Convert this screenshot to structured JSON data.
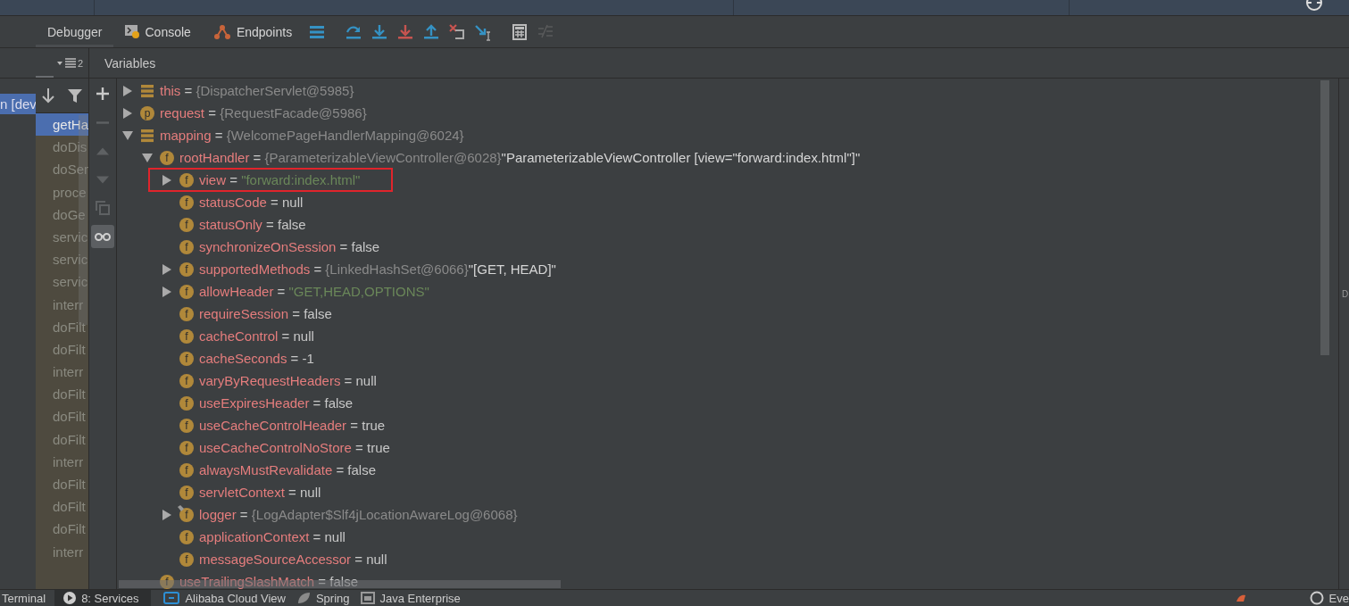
{
  "toolbar": {
    "tabs": [
      {
        "label": "Debugger",
        "selected": true,
        "kind": "plain"
      },
      {
        "label": "Console",
        "selected": false,
        "kind": "console"
      },
      {
        "label": "Endpoints",
        "selected": false,
        "kind": "endpoints"
      }
    ],
    "actions": [
      {
        "kind": "menu",
        "disabled": false
      },
      {
        "kind": "step-over",
        "disabled": false
      },
      {
        "kind": "step-into",
        "disabled": false
      },
      {
        "kind": "force-step-into",
        "disabled": false
      },
      {
        "kind": "step-out",
        "disabled": false
      },
      {
        "kind": "drop-frame",
        "disabled": false
      },
      {
        "kind": "run-to-cursor",
        "disabled": false
      },
      {
        "kind": "calculator",
        "disabled": false
      },
      {
        "kind": "trace",
        "disabled": true
      }
    ]
  },
  "threads": [
    {
      "label": "n [dev",
      "selected": true
    }
  ],
  "frames": {
    "count": "2",
    "items": [
      {
        "label": "getHa",
        "selected": true
      },
      {
        "label": "doDis",
        "selected": false
      },
      {
        "label": "doSer",
        "selected": false
      },
      {
        "label": "proce",
        "selected": false
      },
      {
        "label": "doGe",
        "selected": false
      },
      {
        "label": "servic",
        "selected": false
      },
      {
        "label": "servic",
        "selected": false
      },
      {
        "label": "servic",
        "selected": false
      },
      {
        "label": "interr",
        "selected": false
      },
      {
        "label": "doFilt",
        "selected": false
      },
      {
        "label": "doFilt",
        "selected": false
      },
      {
        "label": "interr",
        "selected": false
      },
      {
        "label": "doFilt",
        "selected": false
      },
      {
        "label": "doFilt",
        "selected": false
      },
      {
        "label": "doFilt",
        "selected": false
      },
      {
        "label": "interr",
        "selected": false
      },
      {
        "label": "doFilt",
        "selected": false
      },
      {
        "label": "doFilt",
        "selected": false
      },
      {
        "label": "doFilt",
        "selected": false
      },
      {
        "label": "interr",
        "selected": false
      }
    ]
  },
  "variables": {
    "title": "Variables",
    "side_actions": [
      {
        "kind": "add",
        "disabled": false,
        "on": false
      },
      {
        "kind": "remove",
        "disabled": true,
        "on": false
      },
      {
        "kind": "up",
        "disabled": true,
        "on": false
      },
      {
        "kind": "down",
        "disabled": true,
        "on": false
      },
      {
        "kind": "copy",
        "disabled": true,
        "on": false
      },
      {
        "kind": "watches",
        "disabled": false,
        "on": true
      }
    ],
    "nodes": [
      {
        "name": "this",
        "sep": "=",
        "value": "{DispatcherServlet@5985}",
        "color": "#8a8a8a",
        "expanded": false,
        "highlighted": false
      },
      {
        "name": "request",
        "badge": "p",
        "sep": "=",
        "value": "{RequestFacade@5986}",
        "color": "#8a8a8a",
        "expanded": false,
        "highlighted": false
      },
      {
        "name": "mapping",
        "sep": "=",
        "value": "{WelcomePageHandlerMapping@6024}",
        "color": "#8a8a8a",
        "expanded": true,
        "highlighted": false,
        "children": [
          {
            "name": "rootHandler",
            "badge": "f",
            "sep": "=",
            "value": "{ParameterizableViewController@6028}",
            "color": "#8a8a8a",
            "extra": "\"ParameterizableViewController [view=\"forward:index.html\"]\"",
            "expanded": true,
            "highlighted": false,
            "children": [
              {
                "name": "view",
                "badge": "f",
                "sep": "=",
                "value": "\"forward:index.html\"",
                "color": "#6a8759",
                "expanded": false,
                "highlighted": true
              },
              {
                "name": "statusCode",
                "badge": "f",
                "sep": "=",
                "value": "null",
                "color": "#c8c8c8",
                "highlighted": false
              },
              {
                "name": "statusOnly",
                "badge": "f",
                "sep": "=",
                "value": "false",
                "color": "#c8c8c8",
                "highlighted": false
              },
              {
                "name": "synchronizeOnSession",
                "badge": "f",
                "sep": "=",
                "value": "false",
                "color": "#c8c8c8",
                "highlighted": false
              },
              {
                "name": "supportedMethods",
                "badge": "f",
                "sep": "=",
                "value": "{LinkedHashSet@6066}",
                "color": "#8a8a8a",
                "extra": "\"[GET, HEAD]\"",
                "expanded": false,
                "highlighted": false
              },
              {
                "name": "allowHeader",
                "badge": "f",
                "sep": "=",
                "value": "\"GET,HEAD,OPTIONS\"",
                "color": "#6a8759",
                "expanded": false,
                "highlighted": false
              },
              {
                "name": "requireSession",
                "badge": "f",
                "sep": "=",
                "value": "false",
                "color": "#c8c8c8",
                "highlighted": false
              },
              {
                "name": "cacheControl",
                "badge": "f",
                "sep": "=",
                "value": "null",
                "color": "#c8c8c8",
                "highlighted": false
              },
              {
                "name": "cacheSeconds",
                "badge": "f",
                "sep": "=",
                "value": "-1",
                "color": "#c8c8c8",
                "highlighted": false
              },
              {
                "name": "varyByRequestHeaders",
                "badge": "f",
                "sep": "=",
                "value": "null",
                "color": "#c8c8c8",
                "highlighted": false
              },
              {
                "name": "useExpiresHeader",
                "badge": "f",
                "sep": "=",
                "value": "false",
                "color": "#c8c8c8",
                "highlighted": false
              },
              {
                "name": "useCacheControlHeader",
                "badge": "f",
                "sep": "=",
                "value": "true",
                "color": "#c8c8c8",
                "highlighted": false
              },
              {
                "name": "useCacheControlNoStore",
                "badge": "f",
                "sep": "=",
                "value": "true",
                "color": "#c8c8c8",
                "highlighted": false
              },
              {
                "name": "alwaysMustRevalidate",
                "badge": "f",
                "sep": "=",
                "value": "false",
                "color": "#c8c8c8",
                "highlighted": false
              },
              {
                "name": "servletContext",
                "badge": "f",
                "sep": "=",
                "value": "null",
                "color": "#c8c8c8",
                "highlighted": false
              },
              {
                "name": "logger",
                "badge": "f",
                "sep": "=",
                "value": "{LogAdapter$Slf4jLocationAwareLog@6068}",
                "color": "#8a8a8a",
                "expanded": false,
                "highlighted": false,
                "marked": true
              },
              {
                "name": "applicationContext",
                "badge": "f",
                "sep": "=",
                "value": "null",
                "color": "#c8c8c8",
                "highlighted": false
              },
              {
                "name": "messageSourceAccessor",
                "badge": "f",
                "sep": "=",
                "value": "null",
                "color": "#c8c8c8",
                "highlighted": false
              }
            ]
          },
          {
            "name": "useTrailingSlashMatch",
            "badge": "f",
            "sep": "=",
            "value": "false",
            "color": "#c8c8c8",
            "highlighted": false
          }
        ]
      }
    ]
  },
  "right_panel": {
    "label": "D"
  },
  "bottom_bar": {
    "tools": [
      {
        "label": "Terminal",
        "selected": false,
        "kind": "plain"
      },
      {
        "label": "8: Services",
        "selected": true,
        "kind": "services"
      },
      {
        "label": "Alibaba Cloud View",
        "selected": false,
        "kind": "cloud"
      },
      {
        "label": "Spring",
        "selected": false,
        "kind": "spring"
      },
      {
        "label": "Java Enterprise",
        "selected": false,
        "kind": "java-ee"
      }
    ],
    "right": {
      "label": "Eve"
    }
  }
}
